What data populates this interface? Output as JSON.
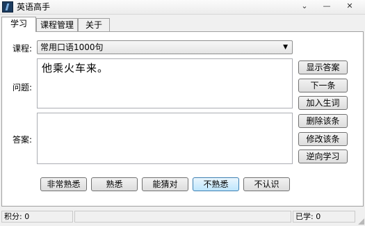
{
  "window": {
    "title": "英语高手"
  },
  "title_buttons": {
    "dropdown": "⌄",
    "minimize": "—",
    "close": "✕"
  },
  "tabs": [
    {
      "label": "学习",
      "active": true
    },
    {
      "label": "课程管理",
      "active": false
    },
    {
      "label": "关于",
      "active": false
    }
  ],
  "course": {
    "label": "课程:",
    "selected": "常用口语1000句"
  },
  "question": {
    "label": "问题:",
    "text": "他乘火车来。"
  },
  "answer": {
    "label": "答案:",
    "text": ""
  },
  "side_buttons": {
    "show_answer": "显示答案",
    "next": "下一条",
    "add_word": "加入生词",
    "delete_entry": "删除该条",
    "edit_entry": "修改该条",
    "reverse_study": "逆向学习"
  },
  "familiarity_buttons": {
    "very_familiar": "非常熟悉",
    "familiar": "熟悉",
    "guessable": "能猜对",
    "unfamiliar": "不熟悉",
    "unknown": "不认识"
  },
  "status": {
    "score": "积分: 0",
    "learned": "已学: 0"
  },
  "colors": {
    "window_bg": "#f0f0f0",
    "panel_bg": "#ffffff",
    "border": "#a0a0a0",
    "focus_button": "#bee6fd"
  }
}
